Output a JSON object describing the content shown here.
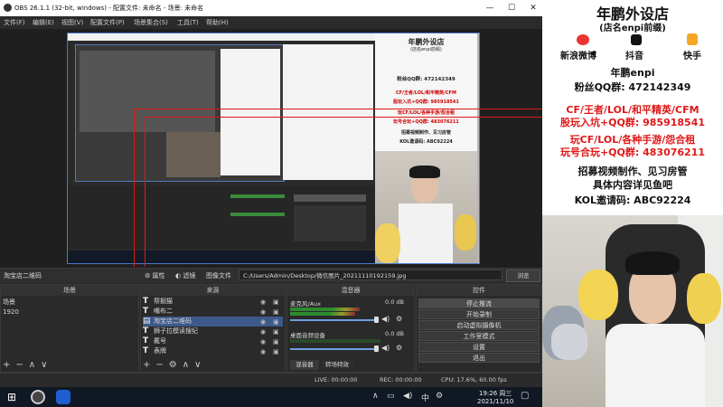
{
  "window": {
    "title": "OBS 26.1.1 (32-bit, windows) - 配置文件: 未命名 - 场景: 未命名",
    "controls": [
      "—",
      "☐",
      "✕"
    ]
  },
  "menu": [
    "文件(F)",
    "编辑(E)",
    "视图(V)",
    "配置文件(P)",
    "场景集合(S)",
    "工具(T)",
    "帮助(H)"
  ],
  "source_toolbar": {
    "current_source": "淘宝店二维码",
    "properties": "属性",
    "filters": "滤镜",
    "image_file_label": "图像文件",
    "path": "C:/Users/Admin/Desktop/微信图片_20211110192159.jpg",
    "browse": "浏览"
  },
  "scenes": {
    "header": "场景",
    "items": [
      "场景",
      "1920"
    ]
  },
  "sources": {
    "header": "来源",
    "items": [
      "帮掘猫",
      "嘴布二",
      "淘宝店二维码",
      "狮子拉模读搜纪",
      "戴号",
      "表牌"
    ]
  },
  "mixer": {
    "header": "混音器",
    "tracks": [
      {
        "name": "麦克风/Aux",
        "db": "0.0 dB",
        "level": 0.55
      },
      {
        "name": "桌面音频设备",
        "db": "0.0 dB",
        "level": 0.0
      }
    ],
    "tabs": [
      "混音器",
      "转场特效"
    ]
  },
  "controls": {
    "header": "控件",
    "buttons": [
      "停止推流",
      "开始录制",
      "启动虚拟摄像机",
      "工作室模式",
      "设置",
      "退出"
    ]
  },
  "status": {
    "live": "LIVE: 00:00:00",
    "rec": "REC: 00:00:00",
    "cpu": "CPU: 17.6%, 60.00 fps"
  },
  "taskbar": {
    "time": "19:26 周三",
    "date": "2021/11/10"
  },
  "poster": {
    "title": "年鹏外设店",
    "subtitle": "(店名enpi前缀)",
    "socials": [
      "新浪微博",
      "抖音",
      "快手"
    ],
    "handle": "年鹏enpi",
    "fans_group": "粉丝QQ群: 472142349",
    "line1": "CF/王者/LOL/和平精英/CFM",
    "line2": "股玩入坑+QQ群: 985918541",
    "line3": "玩CF/LOL/各种手游/怨合租",
    "line4": "玩号合玩+QQ群: 483076211",
    "line5": "招募视频制作、见习房管",
    "line6": "具体内容详见鱼吧",
    "line7": "KOL邀请码: ABC92224"
  },
  "colors": {
    "accent": "#4a78d0",
    "poster_red": "#e01818",
    "obs_bg": "#2b2b2b"
  }
}
